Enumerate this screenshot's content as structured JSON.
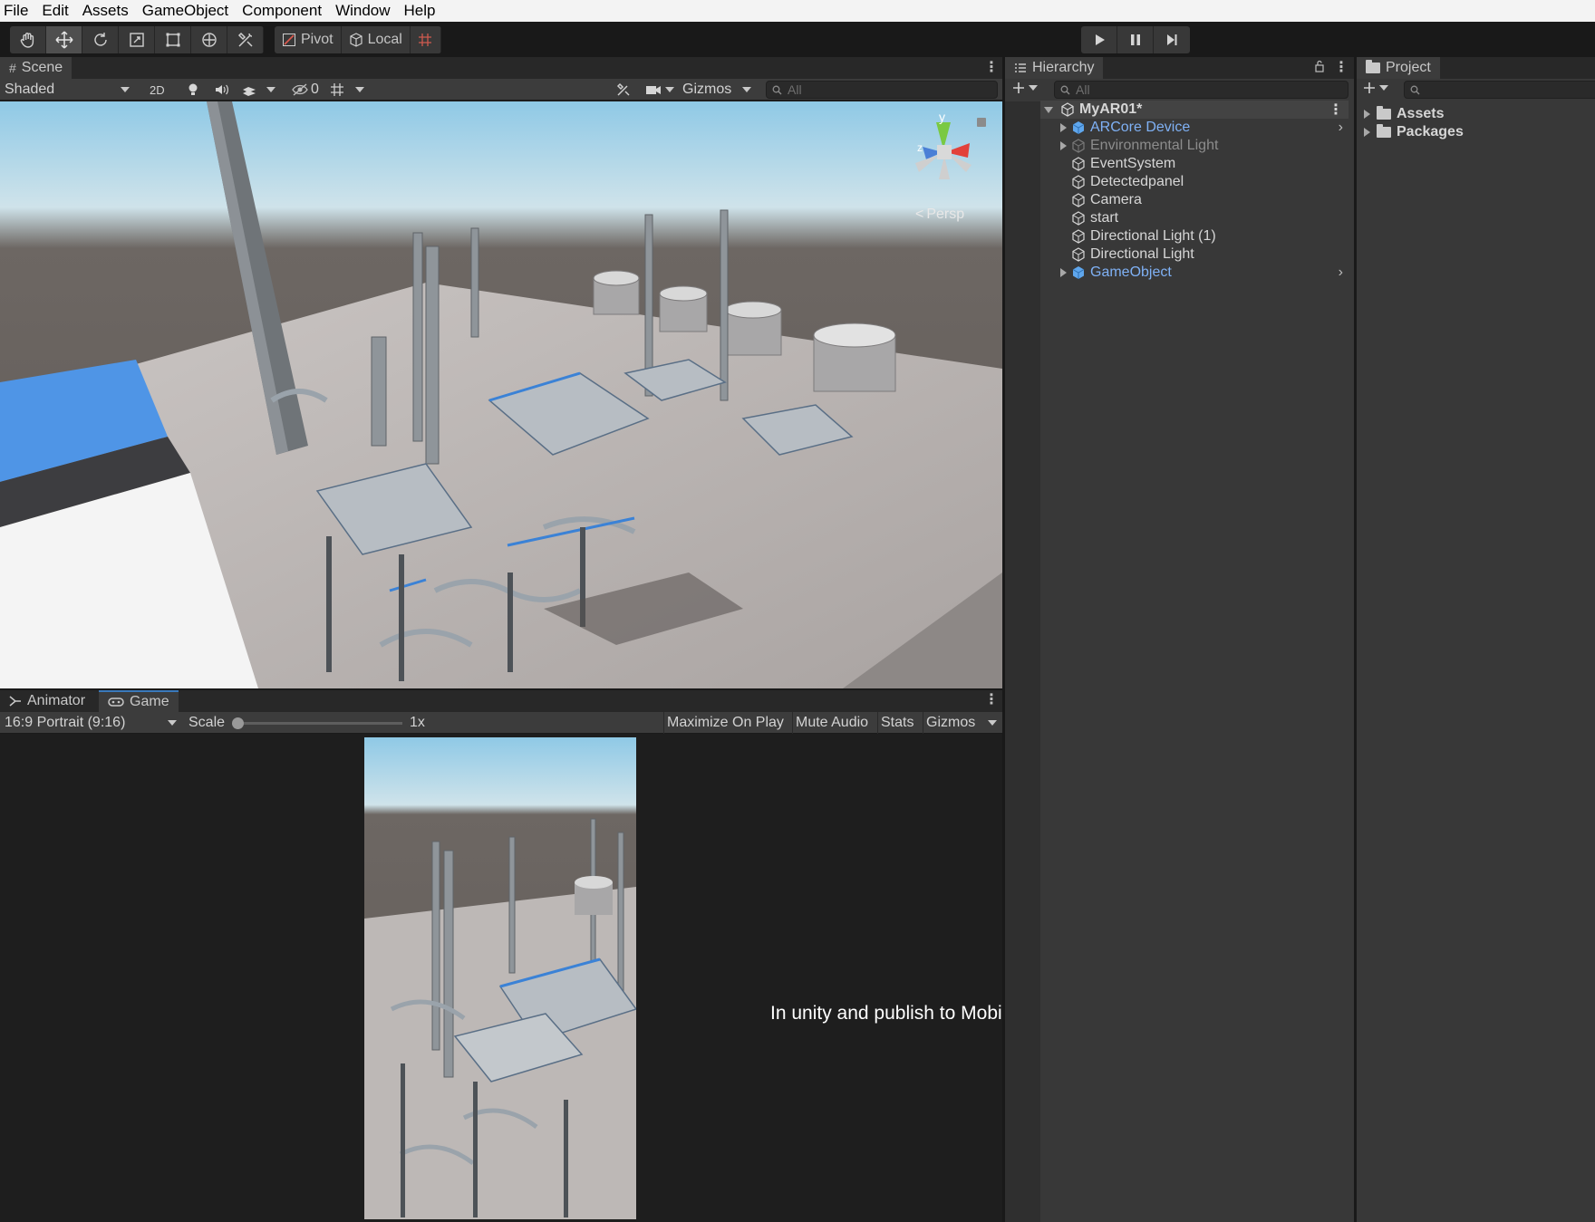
{
  "menu": {
    "items": [
      "File",
      "Edit",
      "Assets",
      "GameObject",
      "Component",
      "Window",
      "Help"
    ]
  },
  "toolbar": {
    "tools": [
      "hand-tool-icon",
      "move-tool-icon",
      "rotate-tool-icon",
      "scale-tool-icon",
      "rect-tool-icon",
      "transform-tool-icon",
      "custom-tool-icon"
    ],
    "pivot_label": "Pivot",
    "local_label": "Local",
    "play_controls": [
      "play-icon",
      "pause-icon",
      "step-icon"
    ]
  },
  "scene": {
    "tab_label": "Scene",
    "shading_mode": "Shaded",
    "mode_2d": "2D",
    "hidden_count": "0",
    "gizmos_label": "Gizmos",
    "search_placeholder": "All",
    "projection_label": "Persp",
    "gizmo_axis_y": "y",
    "gizmo_axis_z": "z"
  },
  "game": {
    "animator_tab": "Animator",
    "game_tab": "Game",
    "aspect": "16:9 Portrait (9:16)",
    "scale_label": "Scale",
    "scale_value": "1x",
    "scale_level": 0,
    "maximize_label": "Maximize On Play",
    "mute_label": "Mute Audio",
    "stats_label": "Stats",
    "gizmos_label": "Gizmos",
    "overlay_text": "In unity and publish to Mobile AR"
  },
  "hierarchy": {
    "tab_label": "Hierarchy",
    "search_placeholder": "All",
    "scene_name": "MyAR01*",
    "items": [
      {
        "label": "ARCore Device",
        "style": "blue",
        "expandable": true
      },
      {
        "label": "Environmental Light",
        "style": "grey",
        "expandable": true
      },
      {
        "label": "EventSystem",
        "style": "normal",
        "expandable": false
      },
      {
        "label": "Detectedpanel",
        "style": "normal",
        "expandable": false
      },
      {
        "label": "Camera",
        "style": "normal",
        "expandable": false
      },
      {
        "label": "start",
        "style": "normal",
        "expandable": false
      },
      {
        "label": "Directional Light (1)",
        "style": "normal",
        "expandable": false
      },
      {
        "label": "Directional Light",
        "style": "normal",
        "expandable": false
      },
      {
        "label": "GameObject",
        "style": "blue",
        "expandable": true
      }
    ]
  },
  "project": {
    "tab_label": "Project",
    "folders": [
      "Assets",
      "Packages"
    ]
  },
  "colors": {
    "accent": "#3a79bb",
    "prefab_blue": "#7fb1f5",
    "panel": "#383838"
  }
}
